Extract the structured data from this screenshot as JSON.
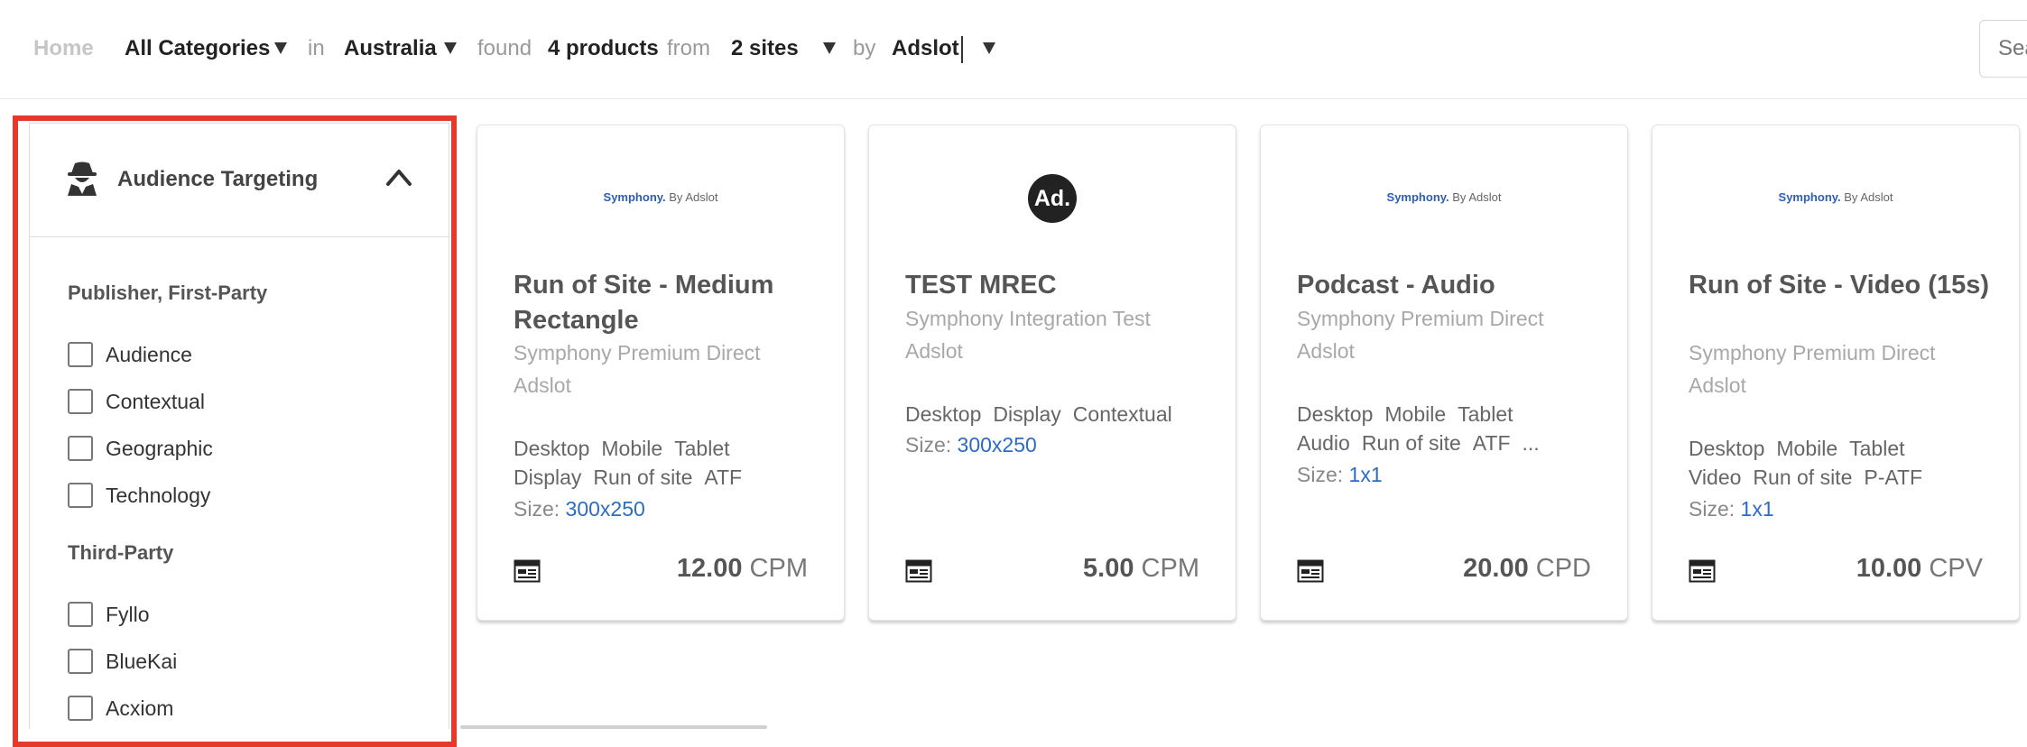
{
  "breadcrumb": {
    "home": "Home",
    "category": "All Categories",
    "in": "in",
    "location": "Australia",
    "found": "found",
    "products": "4 products",
    "from": "from",
    "sites": "2 sites",
    "by": "by",
    "vendor": "Adslot"
  },
  "search": {
    "placeholder": "Sea"
  },
  "sidebar": {
    "title": "Audience Targeting",
    "groups": [
      {
        "title": "Publisher, First-Party",
        "items": [
          "Audience",
          "Contextual",
          "Geographic",
          "Technology"
        ]
      },
      {
        "title": "Third-Party",
        "items": [
          "Fyllo",
          "BlueKai",
          "Acxiom"
        ]
      }
    ]
  },
  "products": [
    {
      "logo_brand": "Symphony.",
      "logo_suffix": " By Adslot",
      "title": "Run of Site - Medium Rectangle",
      "publisher": "Symphony Premium Direct",
      "vendor": "Adslot",
      "tags_line1": [
        "Desktop",
        "Mobile",
        "Tablet"
      ],
      "tags_line2": [
        "Display",
        "Run of site",
        "ATF"
      ],
      "size_label": "Size:",
      "size_value": "300x250",
      "price": "12.00",
      "unit": "CPM"
    },
    {
      "logo_text": "Ad.",
      "title": "TEST MREC",
      "publisher": "Symphony Integration Test",
      "vendor": "Adslot",
      "tags_line1": [
        "Desktop",
        "Display",
        "Contextual"
      ],
      "size_label": "Size:",
      "size_value": "300x250",
      "price": "5.00",
      "unit": "CPM"
    },
    {
      "logo_brand": "Symphony.",
      "logo_suffix": " By Adslot",
      "title": "Podcast - Audio",
      "publisher": "Symphony Premium Direct",
      "vendor": "Adslot",
      "tags_line1": [
        "Desktop",
        "Mobile",
        "Tablet"
      ],
      "tags_line2": [
        "Audio",
        "Run of site",
        "ATF",
        "..."
      ],
      "size_label": "Size:",
      "size_value": "1x1",
      "price": "20.00",
      "unit": "CPD"
    },
    {
      "logo_brand": "Symphony.",
      "logo_suffix": " By Adslot",
      "title": "Run of Site - Video (15s)",
      "publisher": "Symphony Premium Direct",
      "vendor": "Adslot",
      "tags_line1": [
        "Desktop",
        "Mobile",
        "Tablet"
      ],
      "tags_line2": [
        "Video",
        "Run of site",
        "P-ATF"
      ],
      "size_label": "Size:",
      "size_value": "1x1",
      "price": "10.00",
      "unit": "CPV"
    }
  ],
  "colors": {
    "highlight": "#e53a2b",
    "link": "#2b6cc4",
    "brand": "#2b5fb5"
  }
}
